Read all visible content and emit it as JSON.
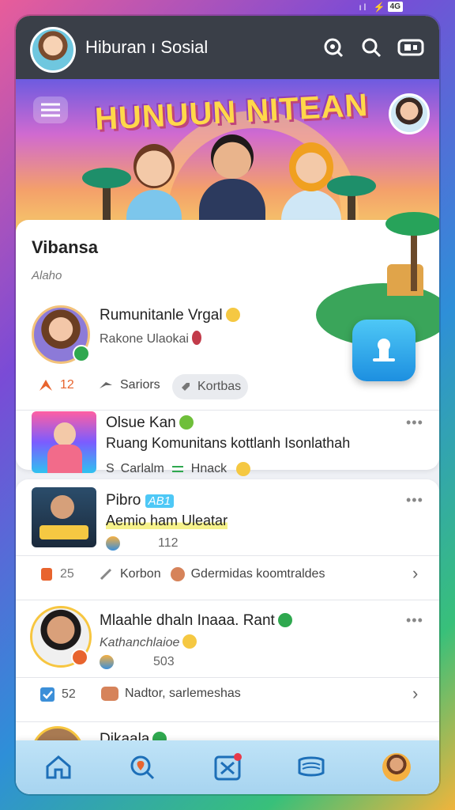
{
  "status": {
    "network": "4G",
    "icons": "ıl ⚡ ⇅"
  },
  "app": {
    "title": "Hiburan ı Sosial"
  },
  "banner": {
    "title": "HUNUUN NITEAN"
  },
  "section": {
    "title": "Vibansa",
    "subtitle": "Alaho"
  },
  "post1": {
    "name": "Rumunitanle Vrgal",
    "subtitle": "Rakone Ulaokai",
    "likes": "12",
    "share_label": "Sariors",
    "tag_label": "Kortbas"
  },
  "post2": {
    "name": "Olsue Kan",
    "text": "Ruang Komunitans kottlanh Isonlathah",
    "meta1": "Carlalm",
    "meta2": "Hnack"
  },
  "post3": {
    "name": "Pibro",
    "tag": "AB1",
    "text": "Aemio ham Uleatar",
    "count": "112",
    "likes": "25",
    "link1": "Korbon",
    "link2": "Gdermidas koomtraldes"
  },
  "post4": {
    "name": "Mlaahle dhaln Inaaa. Rant",
    "subtitle": "Kathanchlaioe",
    "count": "503",
    "likes": "52",
    "link": "Nadtor, sarlemeshas"
  },
  "post5": {
    "name": "Dikaala"
  },
  "colors": {
    "accent": "#1d8fe0",
    "appbar": "#3a3f48",
    "like": "#e8642e",
    "green": "#2fa84f"
  },
  "nav": {
    "items": [
      {
        "icon": "home-icon"
      },
      {
        "icon": "location-search-icon"
      },
      {
        "icon": "games-icon"
      },
      {
        "icon": "messages-icon"
      },
      {
        "icon": "profile-avatar"
      }
    ]
  }
}
